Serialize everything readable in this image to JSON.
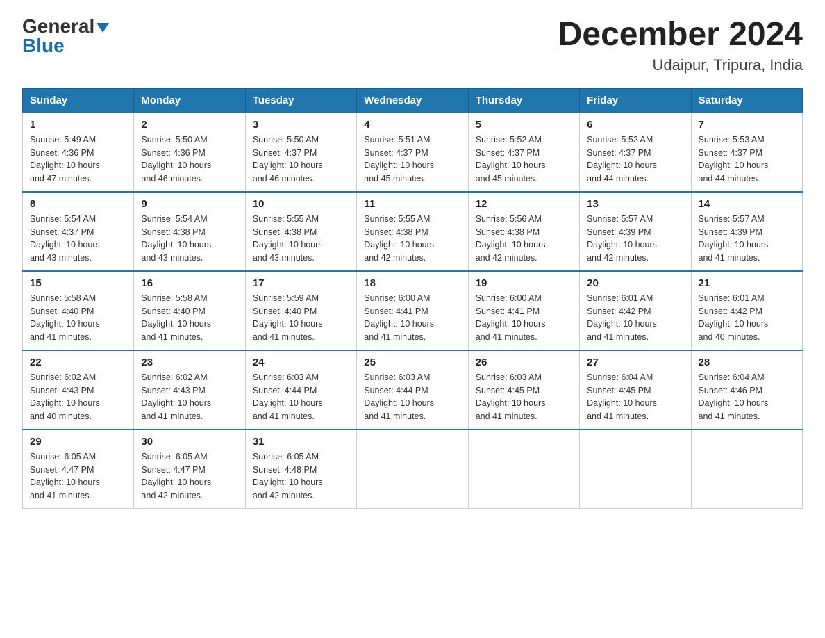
{
  "logo": {
    "general": "General",
    "blue": "Blue"
  },
  "title": "December 2024",
  "location": "Udaipur, Tripura, India",
  "days_of_week": [
    "Sunday",
    "Monday",
    "Tuesday",
    "Wednesday",
    "Thursday",
    "Friday",
    "Saturday"
  ],
  "weeks": [
    [
      {
        "day": "1",
        "sunrise": "5:49 AM",
        "sunset": "4:36 PM",
        "daylight": "10 hours and 47 minutes."
      },
      {
        "day": "2",
        "sunrise": "5:50 AM",
        "sunset": "4:36 PM",
        "daylight": "10 hours and 46 minutes."
      },
      {
        "day": "3",
        "sunrise": "5:50 AM",
        "sunset": "4:37 PM",
        "daylight": "10 hours and 46 minutes."
      },
      {
        "day": "4",
        "sunrise": "5:51 AM",
        "sunset": "4:37 PM",
        "daylight": "10 hours and 45 minutes."
      },
      {
        "day": "5",
        "sunrise": "5:52 AM",
        "sunset": "4:37 PM",
        "daylight": "10 hours and 45 minutes."
      },
      {
        "day": "6",
        "sunrise": "5:52 AM",
        "sunset": "4:37 PM",
        "daylight": "10 hours and 44 minutes."
      },
      {
        "day": "7",
        "sunrise": "5:53 AM",
        "sunset": "4:37 PM",
        "daylight": "10 hours and 44 minutes."
      }
    ],
    [
      {
        "day": "8",
        "sunrise": "5:54 AM",
        "sunset": "4:37 PM",
        "daylight": "10 hours and 43 minutes."
      },
      {
        "day": "9",
        "sunrise": "5:54 AM",
        "sunset": "4:38 PM",
        "daylight": "10 hours and 43 minutes."
      },
      {
        "day": "10",
        "sunrise": "5:55 AM",
        "sunset": "4:38 PM",
        "daylight": "10 hours and 43 minutes."
      },
      {
        "day": "11",
        "sunrise": "5:55 AM",
        "sunset": "4:38 PM",
        "daylight": "10 hours and 42 minutes."
      },
      {
        "day": "12",
        "sunrise": "5:56 AM",
        "sunset": "4:38 PM",
        "daylight": "10 hours and 42 minutes."
      },
      {
        "day": "13",
        "sunrise": "5:57 AM",
        "sunset": "4:39 PM",
        "daylight": "10 hours and 42 minutes."
      },
      {
        "day": "14",
        "sunrise": "5:57 AM",
        "sunset": "4:39 PM",
        "daylight": "10 hours and 41 minutes."
      }
    ],
    [
      {
        "day": "15",
        "sunrise": "5:58 AM",
        "sunset": "4:40 PM",
        "daylight": "10 hours and 41 minutes."
      },
      {
        "day": "16",
        "sunrise": "5:58 AM",
        "sunset": "4:40 PM",
        "daylight": "10 hours and 41 minutes."
      },
      {
        "day": "17",
        "sunrise": "5:59 AM",
        "sunset": "4:40 PM",
        "daylight": "10 hours and 41 minutes."
      },
      {
        "day": "18",
        "sunrise": "6:00 AM",
        "sunset": "4:41 PM",
        "daylight": "10 hours and 41 minutes."
      },
      {
        "day": "19",
        "sunrise": "6:00 AM",
        "sunset": "4:41 PM",
        "daylight": "10 hours and 41 minutes."
      },
      {
        "day": "20",
        "sunrise": "6:01 AM",
        "sunset": "4:42 PM",
        "daylight": "10 hours and 41 minutes."
      },
      {
        "day": "21",
        "sunrise": "6:01 AM",
        "sunset": "4:42 PM",
        "daylight": "10 hours and 40 minutes."
      }
    ],
    [
      {
        "day": "22",
        "sunrise": "6:02 AM",
        "sunset": "4:43 PM",
        "daylight": "10 hours and 40 minutes."
      },
      {
        "day": "23",
        "sunrise": "6:02 AM",
        "sunset": "4:43 PM",
        "daylight": "10 hours and 41 minutes."
      },
      {
        "day": "24",
        "sunrise": "6:03 AM",
        "sunset": "4:44 PM",
        "daylight": "10 hours and 41 minutes."
      },
      {
        "day": "25",
        "sunrise": "6:03 AM",
        "sunset": "4:44 PM",
        "daylight": "10 hours and 41 minutes."
      },
      {
        "day": "26",
        "sunrise": "6:03 AM",
        "sunset": "4:45 PM",
        "daylight": "10 hours and 41 minutes."
      },
      {
        "day": "27",
        "sunrise": "6:04 AM",
        "sunset": "4:45 PM",
        "daylight": "10 hours and 41 minutes."
      },
      {
        "day": "28",
        "sunrise": "6:04 AM",
        "sunset": "4:46 PM",
        "daylight": "10 hours and 41 minutes."
      }
    ],
    [
      {
        "day": "29",
        "sunrise": "6:05 AM",
        "sunset": "4:47 PM",
        "daylight": "10 hours and 41 minutes."
      },
      {
        "day": "30",
        "sunrise": "6:05 AM",
        "sunset": "4:47 PM",
        "daylight": "10 hours and 42 minutes."
      },
      {
        "day": "31",
        "sunrise": "6:05 AM",
        "sunset": "4:48 PM",
        "daylight": "10 hours and 42 minutes."
      },
      null,
      null,
      null,
      null
    ]
  ],
  "labels": {
    "sunrise": "Sunrise:",
    "sunset": "Sunset:",
    "daylight": "Daylight:"
  },
  "accent_color": "#2176ae"
}
